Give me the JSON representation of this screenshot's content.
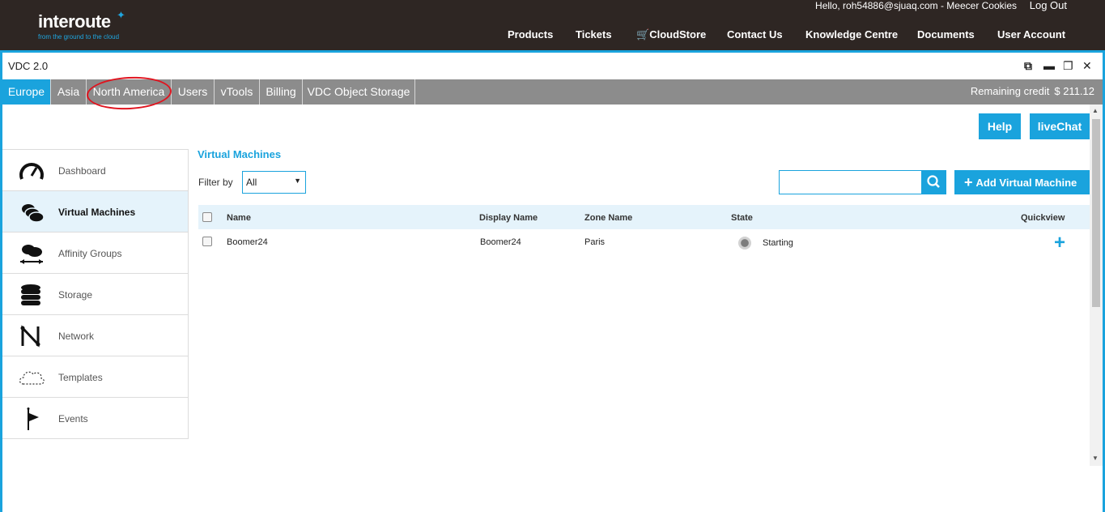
{
  "header": {
    "logo_text": "interoute",
    "logo_tagline": "from the ground to the cloud",
    "greeting": "Hello, roh54886@sjuaq.com - Meecer Cookies",
    "logout": "Log Out",
    "nav": [
      "Products",
      "Tickets",
      "CloudStore",
      "Contact Us",
      "Knowledge Centre",
      "Documents",
      "User Account"
    ]
  },
  "window": {
    "title": "VDC 2.0"
  },
  "tabs": {
    "items": [
      "Europe",
      "Asia",
      "North America",
      "Users",
      "vTools",
      "Billing",
      "VDC Object Storage"
    ],
    "active": "Europe",
    "credit_label": "Remaining credit",
    "credit_amount": "$ 211.12"
  },
  "actions": {
    "help": "Help",
    "livechat": "liveChat"
  },
  "sidebar": {
    "items": [
      {
        "label": "Dashboard",
        "icon": "gauge-icon"
      },
      {
        "label": "Virtual Machines",
        "icon": "cloud-stack-icon"
      },
      {
        "label": "Affinity Groups",
        "icon": "cloud-arrows-icon"
      },
      {
        "label": "Storage",
        "icon": "database-icon"
      },
      {
        "label": "Network",
        "icon": "network-icon"
      },
      {
        "label": "Templates",
        "icon": "dashed-cloud-icon"
      },
      {
        "label": "Events",
        "icon": "flag-icon"
      }
    ],
    "active": "Virtual Machines"
  },
  "main": {
    "title": "Virtual Machines",
    "filter_label": "Filter by",
    "filter_value": "All",
    "search_placeholder": "",
    "add_button": "Add Virtual Machine",
    "columns": [
      "Name",
      "Display Name",
      "Zone Name",
      "State",
      "Quickview"
    ],
    "rows": [
      {
        "name": "Boomer24",
        "display_name": "Boomer24",
        "zone": "Paris",
        "state": "Starting"
      }
    ]
  },
  "colors": {
    "accent": "#1aa3dd",
    "header_bg": "#2e2623",
    "tab_bg": "#8c8c8c",
    "annotation": "#e0141f"
  }
}
